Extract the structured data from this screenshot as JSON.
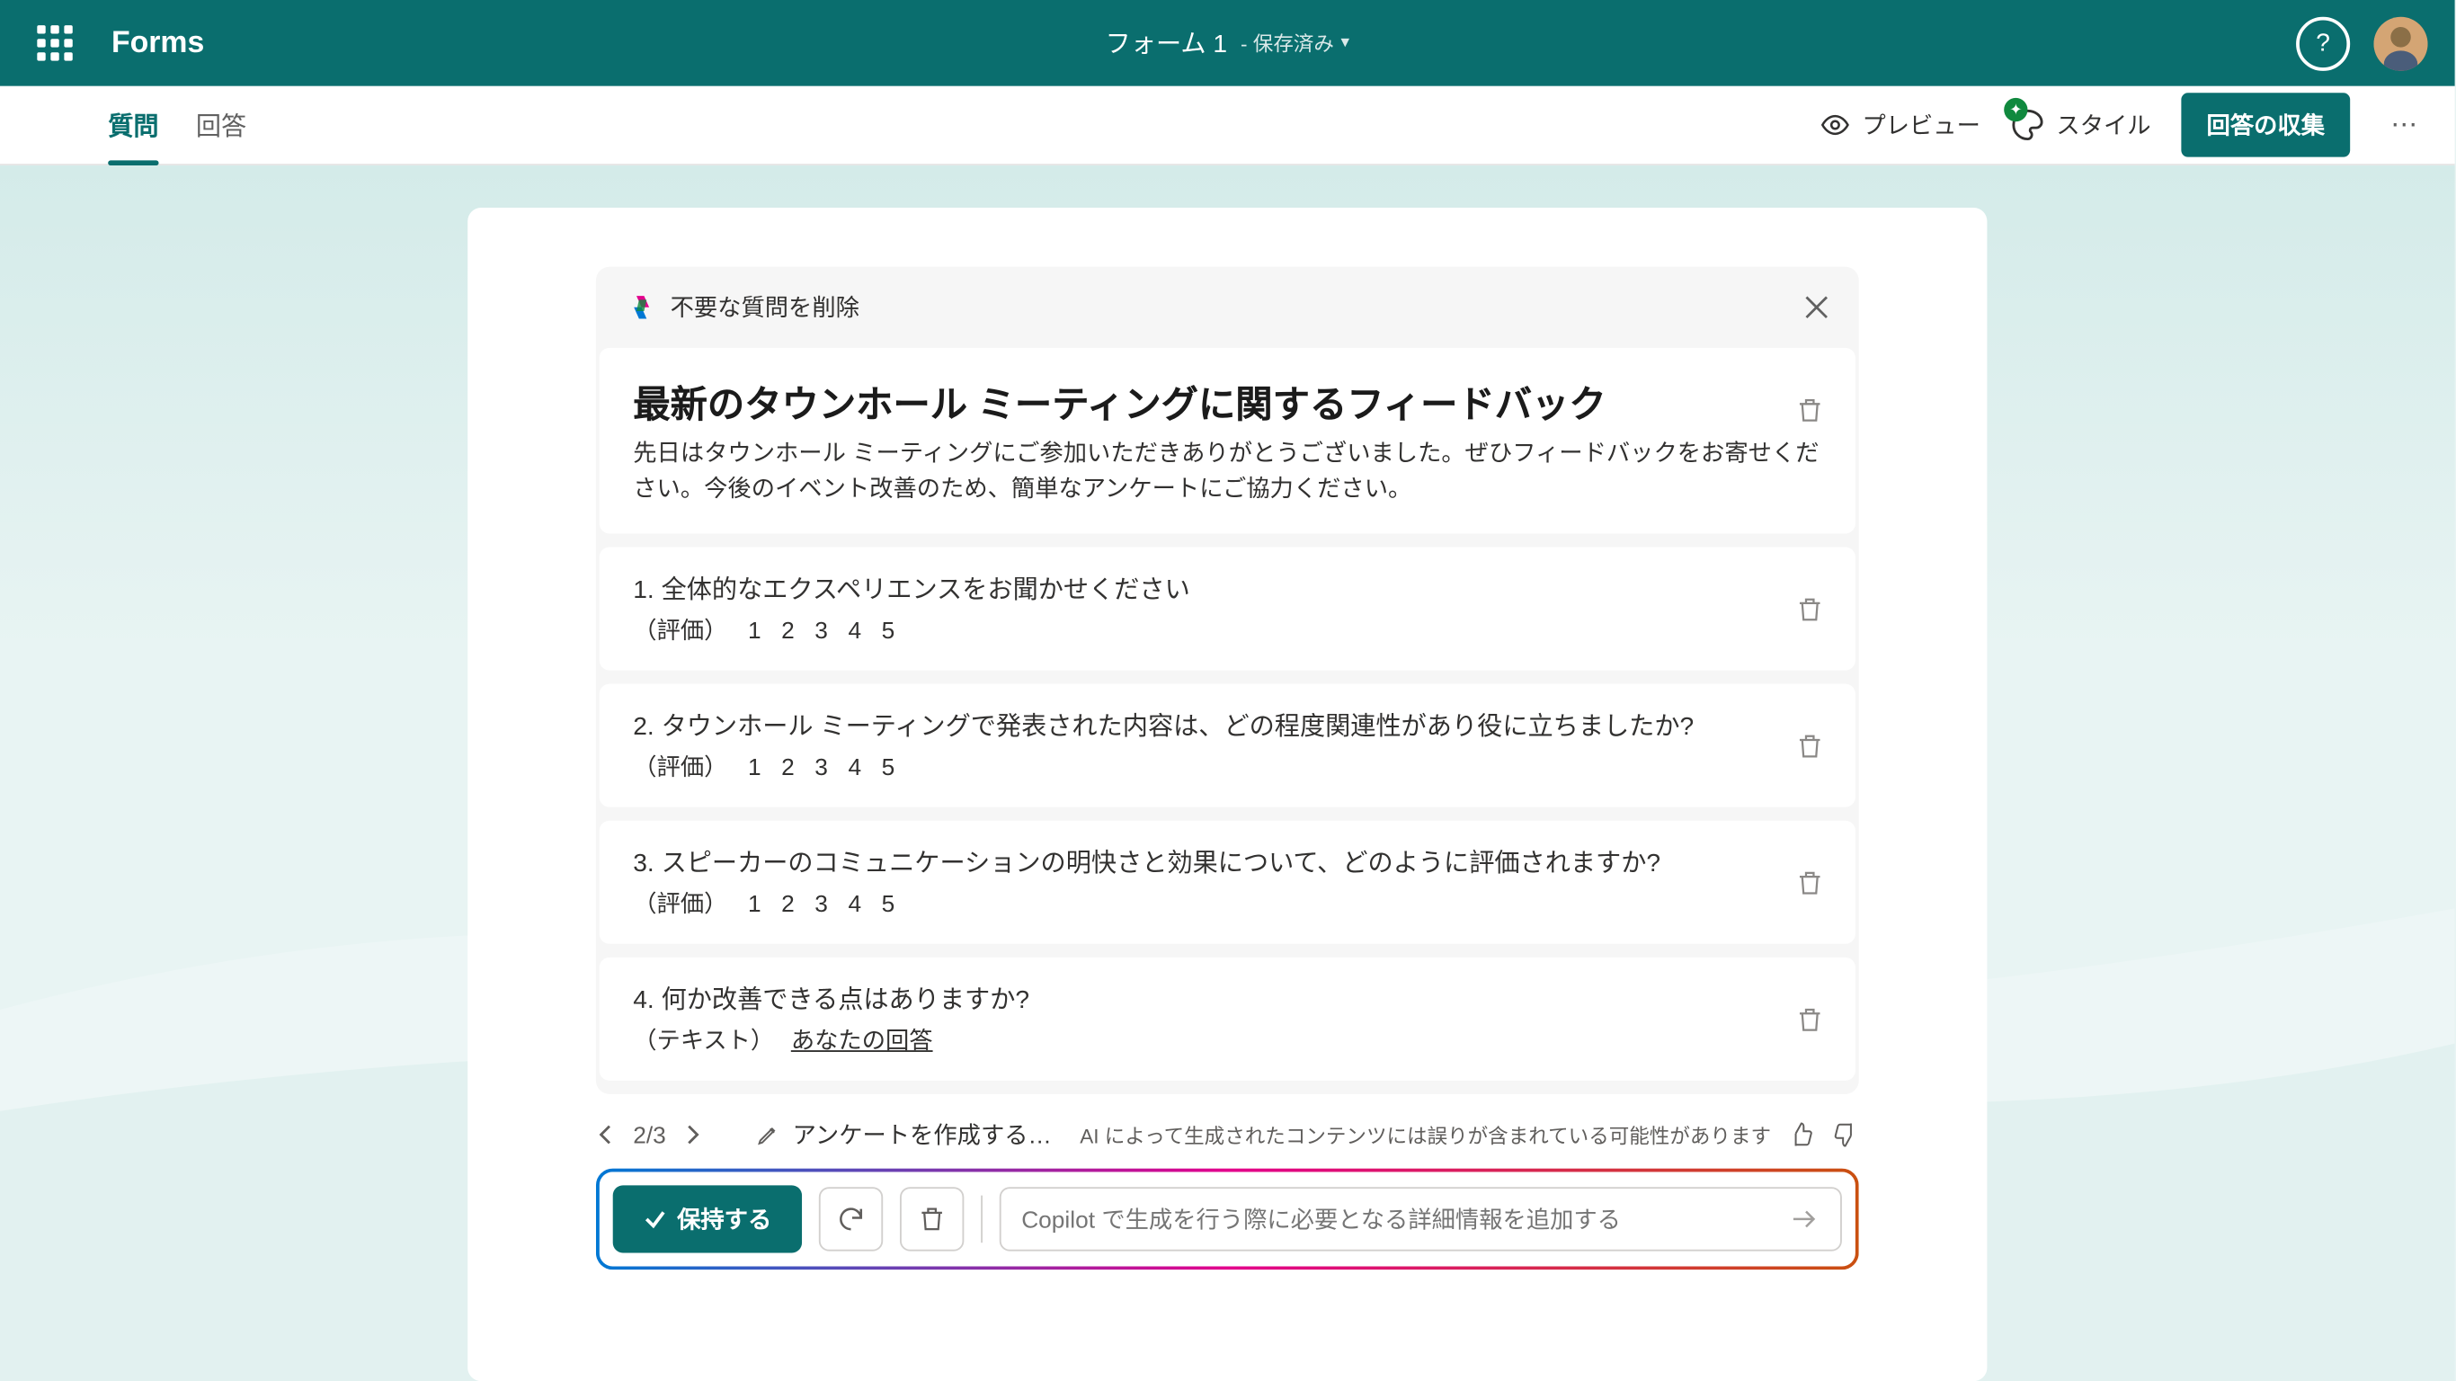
{
  "header": {
    "brand": "Forms",
    "formName": "フォーム 1",
    "saved": "- 保存済み"
  },
  "subbar": {
    "tabs": [
      "質問",
      "回答"
    ],
    "preview": "プレビュー",
    "style": "スタイル",
    "collect": "回答の収集"
  },
  "copilot": {
    "panelTitle": "不要な質問を削除"
  },
  "intro": {
    "title": "最新のタウンホール ミーティングに関するフィードバック",
    "desc": "先日はタウンホール ミーティングにご参加いただきありがとうございました。ぜひフィードバックをお寄せください。今後のイベント改善のため、簡単なアンケートにご協力ください。"
  },
  "questions": [
    {
      "num": "1.",
      "text": "全体的なエクスペリエンスをお聞かせください",
      "type": "（評価）",
      "opts": "1   2   3   4   5"
    },
    {
      "num": "2.",
      "text": "タウンホール ミーティングで発表された内容は、どの程度関連性があり役に立ちましたか?",
      "type": "（評価）",
      "opts": "1   2   3   4   5"
    },
    {
      "num": "3.",
      "text": "スピーカーのコミュニケーションの明快さと効果について、どのように評価されますか?",
      "type": "（評価）",
      "opts": "1   2   3   4   5"
    },
    {
      "num": "4.",
      "text": "何か改善できる点はありますか?",
      "type": "（テキスト）",
      "ans": "あなたの回答"
    }
  ],
  "nav": {
    "page": "2/3",
    "edit": "アンケートを作成する…",
    "disclaimer": "AI によって生成されたコンテンツには誤りが含まれている可能性があります"
  },
  "action": {
    "keep": "保持する",
    "placeholder": "Copilot で生成を行う際に必要となる詳細情報を追加する"
  }
}
